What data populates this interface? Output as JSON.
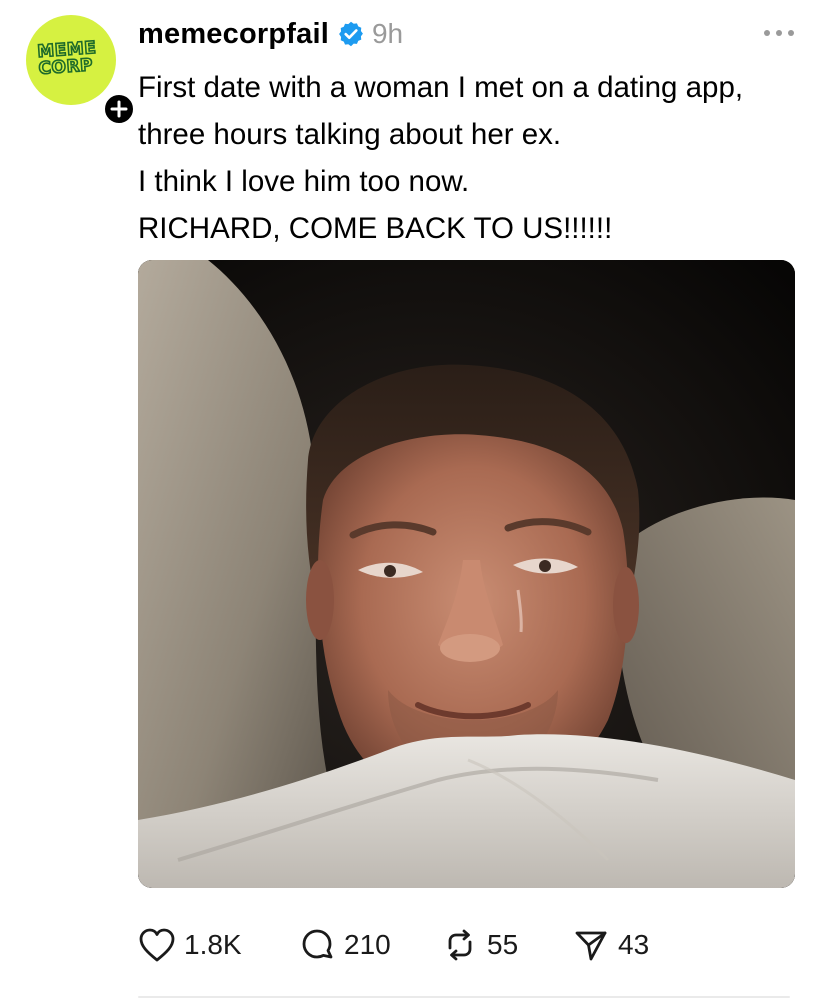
{
  "post": {
    "avatar_text": "MEME\nCORP",
    "username": "memecorpfail",
    "time": "9h",
    "body_lines": [
      "First date with a woman I met on a dating app,",
      "three hours talking about her ex.",
      "I think I love him too now.",
      "RICHARD, COME BACK TO US!!!!!!"
    ],
    "image_description": "Selfie of a tearful man lying in bed under a white blanket in the dark"
  },
  "actions": {
    "likes": "1.8K",
    "replies": "210",
    "reposts": "55",
    "shares": "43"
  },
  "icons": {
    "avatar": "meme-corp-logo",
    "follow": "plus-icon",
    "verified": "verified-badge-icon",
    "more": "more-options-icon",
    "like": "heart-icon",
    "reply": "comment-icon",
    "repost": "repost-icon",
    "share": "send-icon"
  },
  "colors": {
    "verified": "#1d9bf0",
    "avatar_bg": "#d6f141",
    "muted": "#9a9a9a"
  }
}
